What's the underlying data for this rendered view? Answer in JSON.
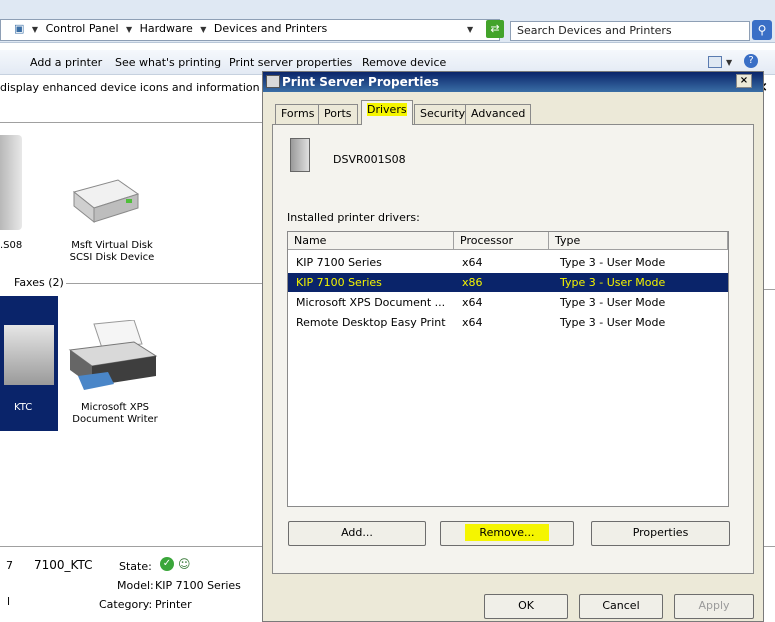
{
  "breadcrumb": [
    "Control Panel",
    "Hardware",
    "Devices and Printers"
  ],
  "search": {
    "placeholder": "Search Devices and Printers"
  },
  "commands": {
    "add_printer": "Add a printer",
    "whats_printing": "See what's printing",
    "server_props": "Print server properties",
    "remove_device": "Remove device"
  },
  "info_bar": {
    "text": "display enhanced device icons and information fro"
  },
  "devices": [
    {
      "label": ".S08"
    },
    {
      "label": "Msft Virtual Disk SCSI Disk Device"
    }
  ],
  "printers_section": {
    "label": "Faxes (2)"
  },
  "printers": [
    {
      "label": "KTC"
    },
    {
      "label": "Microsoft XPS Document Writer"
    }
  ],
  "details": {
    "name": "7100_KTC",
    "state_label": "State:",
    "model_label": "Model:",
    "model": "KIP 7100 Series",
    "category_label": "Category:",
    "category": "Printer",
    "left_marks": [
      "7",
      "l"
    ]
  },
  "dialog": {
    "title": "Print Server Properties",
    "tabs": [
      "Forms",
      "Ports",
      "Drivers",
      "Security",
      "Advanced"
    ],
    "active_tab": "Drivers",
    "server_name": "DSVR001S08",
    "list_label": "Installed printer drivers:",
    "columns": [
      "Name",
      "Processor",
      "Type"
    ],
    "rows": [
      {
        "name": "KIP 7100 Series",
        "processor": "x64",
        "type": "Type 3 - User Mode",
        "selected": false
      },
      {
        "name": "KIP 7100 Series",
        "processor": "x86",
        "type": "Type 3 - User Mode",
        "selected": true
      },
      {
        "name": "Microsoft XPS Document ...",
        "processor": "x64",
        "type": "Type 3 - User Mode",
        "selected": false
      },
      {
        "name": "Remote Desktop Easy Print",
        "processor": "x64",
        "type": "Type 3 - User Mode",
        "selected": false
      }
    ],
    "buttons": {
      "add": "Add...",
      "remove": "Remove...",
      "properties": "Properties",
      "ok": "OK",
      "cancel": "Cancel",
      "apply": "Apply"
    }
  },
  "colors": {
    "title_bar": "#0a246a",
    "selection": "#0a246a",
    "highlight": "#f5f500",
    "dialog_bg": "#ece9d8"
  }
}
